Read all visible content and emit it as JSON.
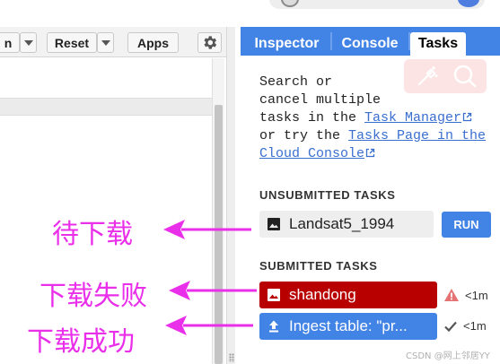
{
  "toolbar": {
    "run_fragment": "n",
    "reset_label": "Reset",
    "apps_label": "Apps",
    "gear_icon": "gear-icon"
  },
  "tabs": [
    {
      "label": "Inspector",
      "active": false
    },
    {
      "label": "Console",
      "active": false
    },
    {
      "label": "Tasks",
      "active": true
    }
  ],
  "help": {
    "line1": "Search or",
    "line2": "cancel multiple",
    "line3_prefix": "tasks in the ",
    "task_manager_link": "Task Manager",
    "line4_prefix": "or try the ",
    "tasks_page_link_1": "Tasks Page in the",
    "tasks_page_link_2": "Cloud Console"
  },
  "unsubmitted": {
    "heading": "UNSUBMITTED TASKS",
    "tasks": [
      {
        "name": "Landsat5_1994",
        "icon": "image-icon",
        "action": "RUN"
      }
    ]
  },
  "submitted": {
    "heading": "SUBMITTED TASKS",
    "tasks": [
      {
        "name": "shandong",
        "icon": "image-icon",
        "status": "failed",
        "status_icon": "warning-icon",
        "age": "<1m"
      },
      {
        "name": "Ingest table: \"pr...",
        "icon": "upload-icon",
        "status": "completed",
        "status_icon": "check-icon",
        "age": "<1m"
      }
    ]
  },
  "annotations": {
    "pending": "待下载",
    "failed": "下载失败",
    "success": "下载成功"
  },
  "credit": "CSDN @网上邻居YY",
  "colors": {
    "tab_bar": "#4283e6",
    "failed_bg": "#b80000",
    "done_bg": "#4283e6",
    "run_button": "#4283e6",
    "annotation": "#ea2fea",
    "link": "#3a6fd0"
  }
}
